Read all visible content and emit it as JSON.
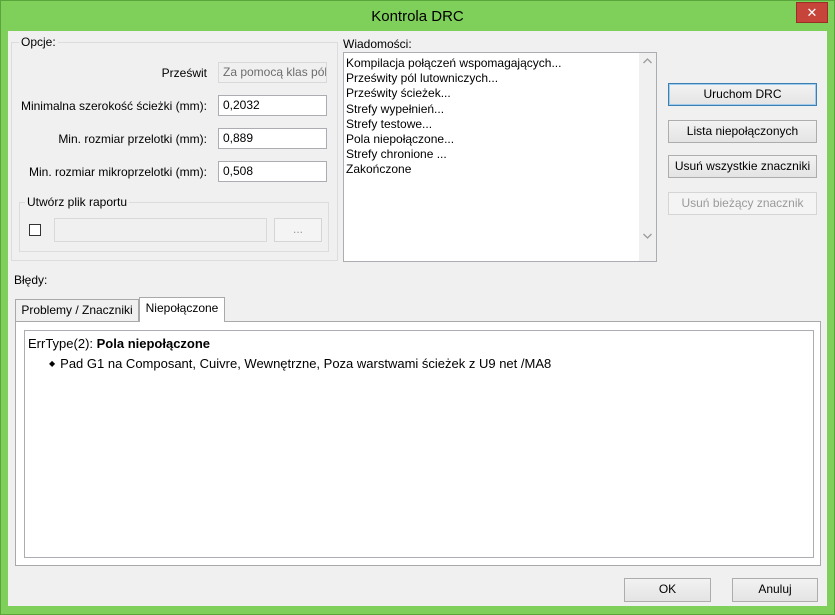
{
  "window": {
    "title": "Kontrola DRC",
    "close_glyph": "✕"
  },
  "options": {
    "legend": "Opcje:",
    "clearance_label": "Prześwit",
    "clearance_value": "Za pomocą klas pól",
    "min_track_label": "Minimalna szerokość ścieżki (mm):",
    "min_track_value": "0,2032",
    "min_via_label": "Min. rozmiar przelotki (mm):",
    "min_via_value": "0,889",
    "min_uvia_label": "Min. rozmiar mikroprzelotki (mm):",
    "min_uvia_value": "0,508",
    "report": {
      "legend": "Utwórz plik raportu",
      "checked": false,
      "path_value": "",
      "browse_label": "..."
    }
  },
  "messages": {
    "label": "Wiadomości:",
    "lines": [
      "Kompilacja połączeń wspomagających...",
      "Prześwity pól lutowniczych...",
      "Prześwity ścieżek...",
      "Strefy wypełnień...",
      "Strefy testowe...",
      "Pola niepołączone...",
      "Strefy chronione ...",
      "Zakończone"
    ]
  },
  "actions": {
    "run_drc": "Uruchom DRC",
    "list_unconnected": "Lista niepołączonych",
    "delete_all_markers": "Usuń wszystkie znaczniki",
    "delete_current_marker": "Usuń bieżący znacznik"
  },
  "errors": {
    "label": "Błędy:",
    "tabs": [
      {
        "label": "Problemy / Znaczniki",
        "active": false
      },
      {
        "label": "Niepołączone",
        "active": true
      }
    ],
    "entry": {
      "type_prefix": "ErrType(2): ",
      "type_title": "Pola niepołączone",
      "bullet": "◆",
      "detail": "Pad G1 na Composant, Cuivre, Wewnętrzne, Poza warstwami ścieżek z U9 net /MA8"
    }
  },
  "footer": {
    "ok": "OK",
    "cancel": "Anuluj"
  }
}
